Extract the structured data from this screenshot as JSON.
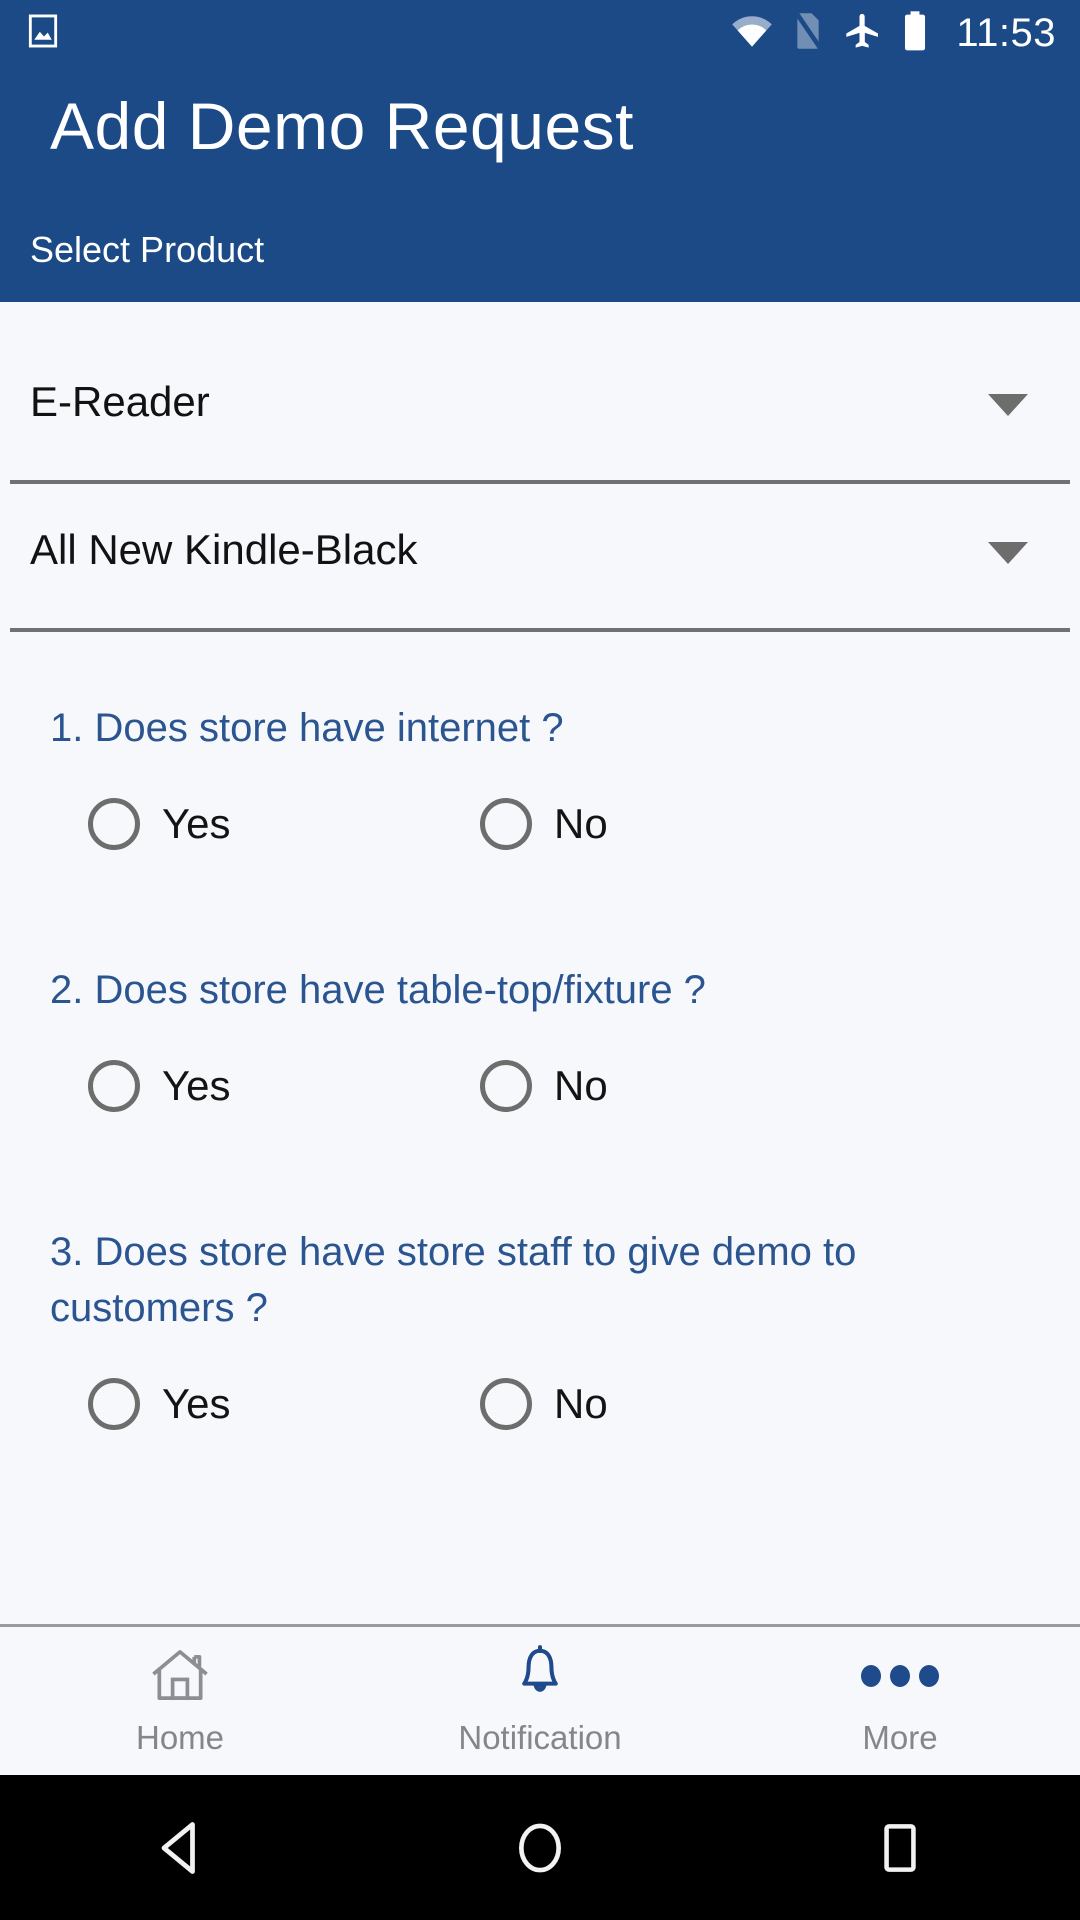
{
  "status_bar": {
    "time": "11:53",
    "icons": [
      "photo-icon",
      "wifi-icon",
      "no-sim-icon",
      "airplane-mode-icon",
      "battery-icon"
    ]
  },
  "app_bar": {
    "title": "Add Demo Request",
    "subtitle": "Select Product",
    "background_color": "#1b4a87"
  },
  "form": {
    "product_spinner": {
      "value": "E-Reader",
      "caret": "chevron-down-icon"
    },
    "model_spinner": {
      "value": "All New Kindle-Black",
      "caret": "chevron-down-icon"
    },
    "question_color": "#2b5590",
    "questions": [
      {
        "text": "1. Does store have internet ?",
        "options": [
          {
            "label": "Yes",
            "selected": false
          },
          {
            "label": "No",
            "selected": false
          }
        ]
      },
      {
        "text": "2. Does store have table-top/fixture ?",
        "options": [
          {
            "label": "Yes",
            "selected": false
          },
          {
            "label": "No",
            "selected": false
          }
        ]
      },
      {
        "text": "3. Does store have store staff to give demo to customers ?",
        "options": [
          {
            "label": "Yes",
            "selected": false
          },
          {
            "label": "No",
            "selected": false
          }
        ]
      }
    ]
  },
  "bottom_nav": {
    "items": [
      {
        "label": "Home",
        "icon": "home-icon",
        "active": false
      },
      {
        "label": "Notification",
        "icon": "bell-icon",
        "active": true
      },
      {
        "label": "More",
        "icon": "more-dots-icon",
        "active": true
      }
    ],
    "accent_color": "#1f4a8c",
    "label_color": "#85858a"
  },
  "system_nav": {
    "buttons": [
      "back-button",
      "home-button",
      "recents-button"
    ],
    "background_color": "#000000"
  }
}
